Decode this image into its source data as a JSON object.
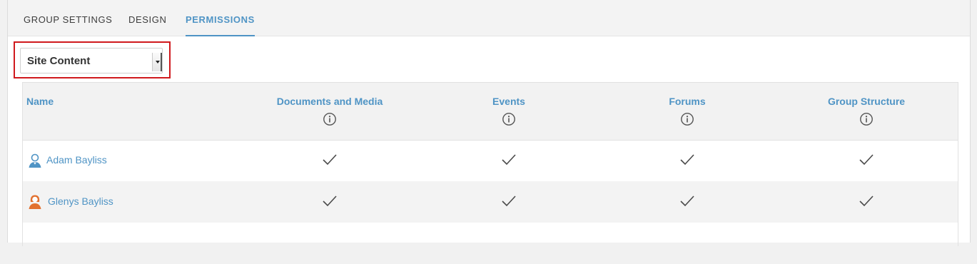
{
  "tabs": [
    {
      "label": "GROUP SETTINGS",
      "active": false
    },
    {
      "label": "DESIGN",
      "active": false
    },
    {
      "label": "PERMISSIONS",
      "active": true
    }
  ],
  "scope_select": {
    "value": "Site Content"
  },
  "table": {
    "columns": [
      {
        "label": "Name",
        "info_icon": false
      },
      {
        "label": "Documents and Media",
        "info_icon": true
      },
      {
        "label": "Events",
        "info_icon": true
      },
      {
        "label": "Forums",
        "info_icon": true
      },
      {
        "label": "Group Structure",
        "info_icon": true
      }
    ],
    "rows": [
      {
        "name": "Adam Bayliss",
        "avatar": "male-user-icon",
        "avatar_color": "#4f94c5",
        "permissions": [
          true,
          true,
          true,
          true
        ]
      },
      {
        "name": "Glenys Bayliss",
        "avatar": "female-user-icon",
        "avatar_color": "#e2712f",
        "permissions": [
          true,
          true,
          true,
          true
        ]
      }
    ]
  },
  "colors": {
    "accent": "#4f94c5",
    "highlight": "#d0191d",
    "check": "#4a4a4a"
  }
}
